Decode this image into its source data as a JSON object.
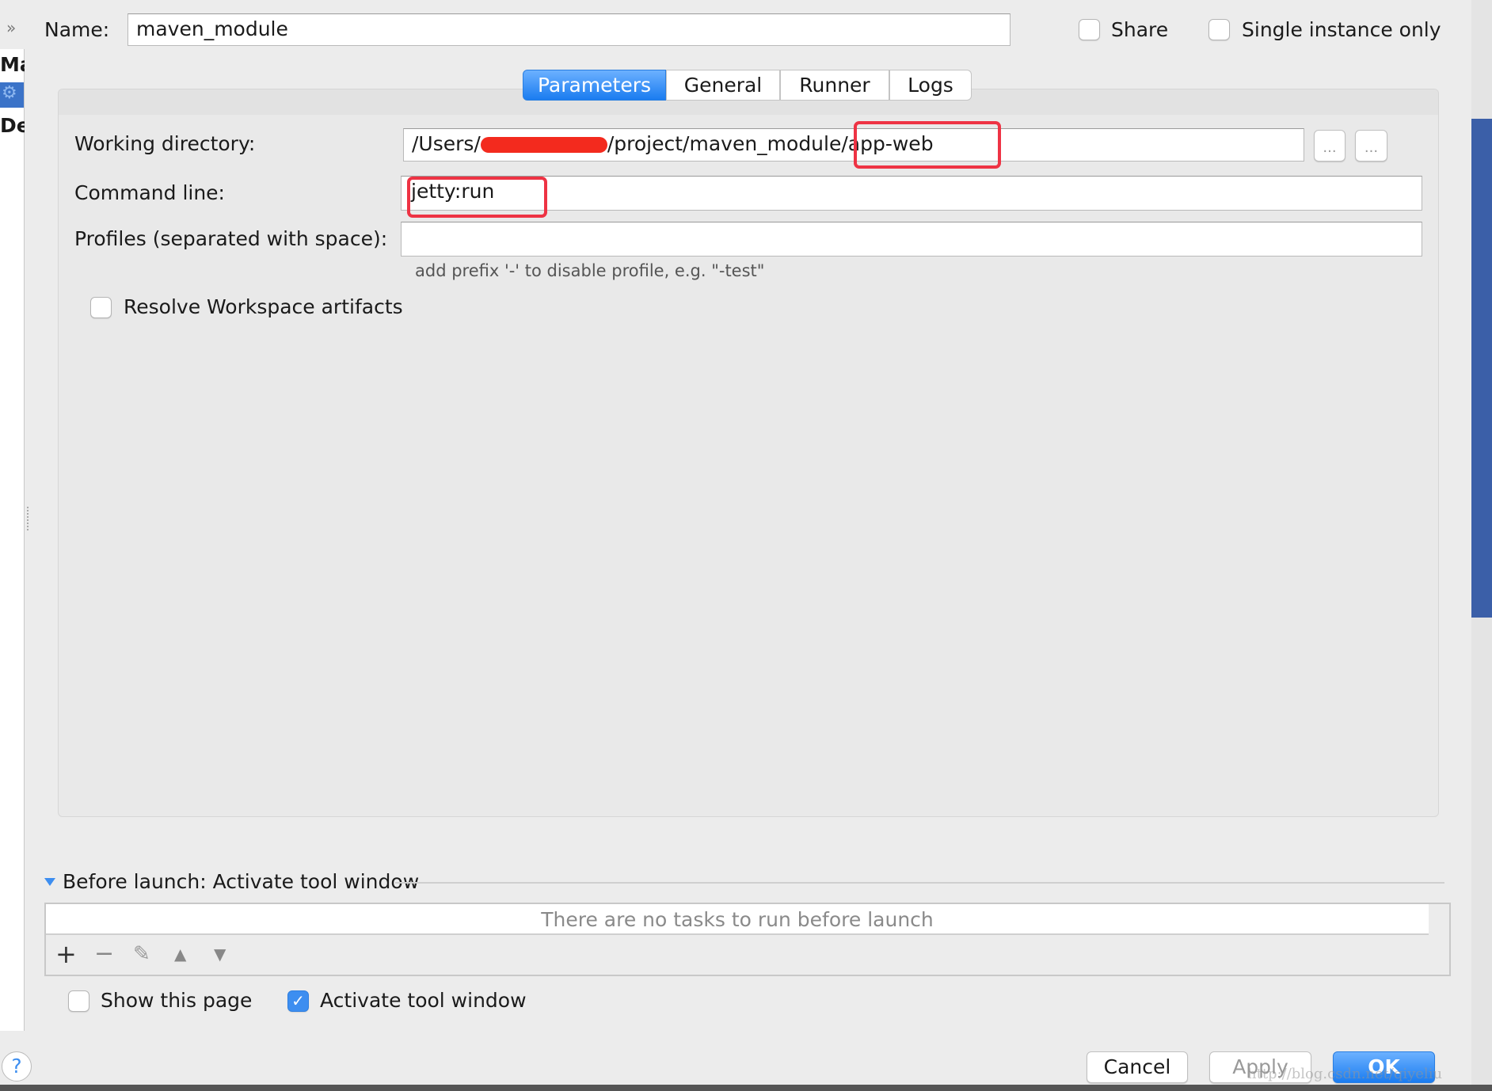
{
  "header": {
    "expand_icon": "»",
    "name_label": "Name:",
    "name_value": "maven_module",
    "share_label": "Share",
    "single_instance_label": "Single instance only"
  },
  "sidebar": {
    "items": [
      "Ma",
      "De"
    ]
  },
  "tabs": [
    {
      "label": "Parameters",
      "active": true
    },
    {
      "label": "General"
    },
    {
      "label": "Runner"
    },
    {
      "label": "Logs"
    }
  ],
  "parameters": {
    "working_directory_label": "Working directory:",
    "working_directory_prefix": "/Users/",
    "working_directory_middle": "/project/maven_module",
    "working_directory_suffix": "/app-web",
    "browse_button_label": "...",
    "macro_button_label": "...",
    "command_line_label": "Command line:",
    "command_line_value": "jetty:run",
    "profiles_label": "Profiles (separated with space):",
    "profiles_value": "",
    "profiles_hint": "add prefix '-' to disable profile, e.g. \"-test\"",
    "resolve_workspace_label": "Resolve Workspace artifacts",
    "resolve_workspace_checked": false
  },
  "before_launch": {
    "title": "Before launch: Activate tool window",
    "empty_text": "There are no tasks to run before launch",
    "toolbar": [
      "plus-icon",
      "minus-icon",
      "pencil-icon",
      "arrow-up-icon",
      "arrow-down-icon"
    ]
  },
  "options": {
    "show_this_page_label": "Show this page",
    "show_this_page_checked": false,
    "activate_tool_window_label": "Activate tool window",
    "activate_tool_window_checked": true
  },
  "footer": {
    "help_label": "?",
    "cancel_label": "Cancel",
    "apply_label": "Apply",
    "ok_label": "OK",
    "watermark": "http://blog.csdn.net/qiyeliu"
  },
  "colors": {
    "accent": "#1a7cf0",
    "highlight_annotation": "#ee3344"
  }
}
